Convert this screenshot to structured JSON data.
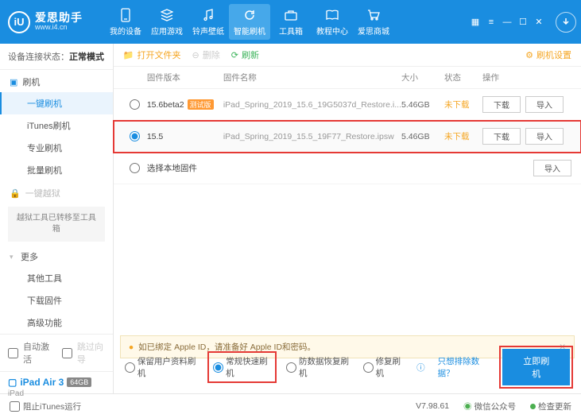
{
  "app": {
    "name": "爱思助手",
    "url": "www.i4.cn",
    "logo_letter": "iU"
  },
  "nav": [
    {
      "label": "我的设备"
    },
    {
      "label": "应用游戏"
    },
    {
      "label": "铃声壁纸"
    },
    {
      "label": "智能刷机"
    },
    {
      "label": "工具箱"
    },
    {
      "label": "教程中心"
    },
    {
      "label": "爱思商城"
    }
  ],
  "conn": {
    "prefix": "设备连接状态：",
    "value": "正常模式"
  },
  "sidebar": {
    "g1": {
      "title": "刷机",
      "items": [
        "一键刷机",
        "iTunes刷机",
        "专业刷机",
        "批量刷机"
      ]
    },
    "g2": {
      "title": "一键越狱",
      "note": "越狱工具已转移至工具箱"
    },
    "g3": {
      "title": "更多",
      "items": [
        "其他工具",
        "下载固件",
        "高级功能"
      ]
    },
    "auto_activate": "自动激活",
    "skip_guide": "跳过向导",
    "device": {
      "name": "iPad Air 3",
      "storage": "64GB",
      "model": "iPad"
    }
  },
  "toolbar": {
    "open": "打开文件夹",
    "delete": "删除",
    "refresh": "刷新",
    "settings": "刷机设置"
  },
  "columns": {
    "ver": "固件版本",
    "name": "固件名称",
    "size": "大小",
    "status": "状态",
    "op": "操作"
  },
  "rows": [
    {
      "ver": "15.6beta2",
      "beta": "测试版",
      "name": "iPad_Spring_2019_15.6_19G5037d_Restore.i...",
      "size": "5.46GB",
      "status": "未下载",
      "selected": false
    },
    {
      "ver": "15.5",
      "name": "iPad_Spring_2019_15.5_19F77_Restore.ipsw",
      "size": "5.46GB",
      "status": "未下载",
      "selected": true
    }
  ],
  "local_fw": "选择本地固件",
  "btn": {
    "download": "下载",
    "import": "导入"
  },
  "warn": "如已绑定 Apple ID，请准备好 Apple ID和密码。",
  "modes": {
    "keep": "保留用户资料刷机",
    "normal": "常规快速刷机",
    "recover": "防数据恢复刷机",
    "repair": "修复刷机",
    "exclude": "只想排除数据？",
    "go": "立即刷机"
  },
  "status": {
    "block_itunes": "阻止iTunes运行",
    "version": "V7.98.61",
    "wechat": "微信公众号",
    "update": "检查更新"
  }
}
